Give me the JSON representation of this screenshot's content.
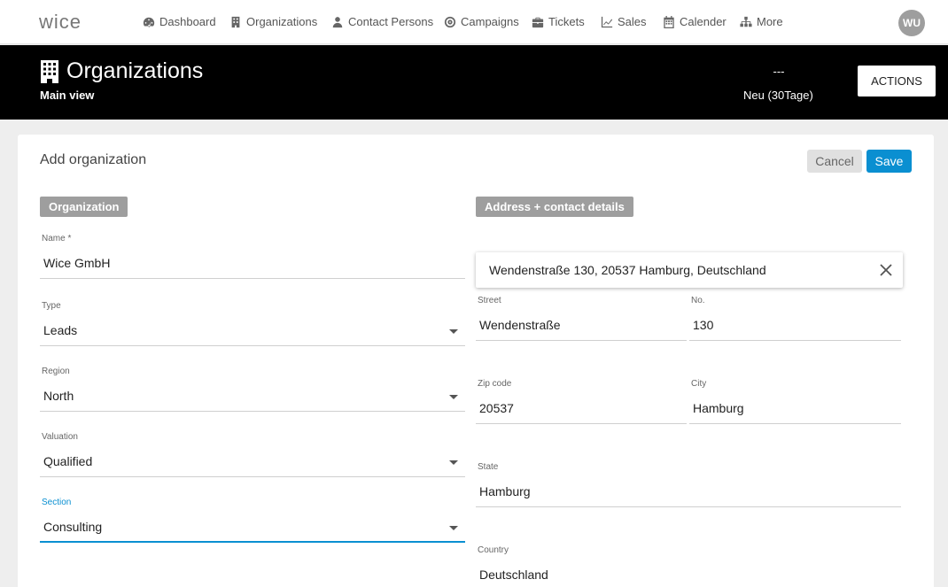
{
  "nav": {
    "logo_text": "wice",
    "items": [
      {
        "label": "Dashboard",
        "icon": "dashboard-icon"
      },
      {
        "label": "Organizations",
        "icon": "building-icon"
      },
      {
        "label": "Contact Persons",
        "icon": "person-icon"
      },
      {
        "label": "Campaigns",
        "icon": "target-icon"
      },
      {
        "label": "Tickets",
        "icon": "briefcase-icon"
      },
      {
        "label": "Sales",
        "icon": "chart-line-icon"
      },
      {
        "label": "Calender",
        "icon": "calendar-icon"
      },
      {
        "label": "More",
        "icon": "sitemap-icon"
      }
    ],
    "avatar": "WU"
  },
  "header": {
    "title": "Organizations",
    "subtitle": "Main view",
    "stat_value": "---",
    "stat_label": "Neu (30Tage)",
    "actions_label": "ACTIONS"
  },
  "form": {
    "title": "Add organization",
    "cancel_label": "Cancel",
    "save_label": "Save",
    "left_section": "Organization",
    "right_section": "Address + contact details",
    "name": {
      "label": "Name *",
      "value": "Wice GmbH"
    },
    "type": {
      "label": "Type",
      "value": "Leads"
    },
    "region": {
      "label": "Region",
      "value": "North"
    },
    "valuation": {
      "label": "Valuation",
      "value": "Qualified"
    },
    "section": {
      "label": "Section",
      "value": "Consulting"
    },
    "address_search": "Wendenstraße 130, 20537 Hamburg, Deutschland",
    "street": {
      "label": "Street",
      "value": "Wendenstraße"
    },
    "no": {
      "label": "No.",
      "value": "130"
    },
    "zip": {
      "label": "Zip code",
      "value": "20537"
    },
    "city": {
      "label": "City",
      "value": "Hamburg"
    },
    "state": {
      "label": "State",
      "value": "Hamburg"
    },
    "country": {
      "label": "Country",
      "value": "Deutschland"
    }
  },
  "colors": {
    "accent": "#0a8fd1",
    "header_bg": "#000000",
    "badge_bg": "#9e9e9e"
  }
}
